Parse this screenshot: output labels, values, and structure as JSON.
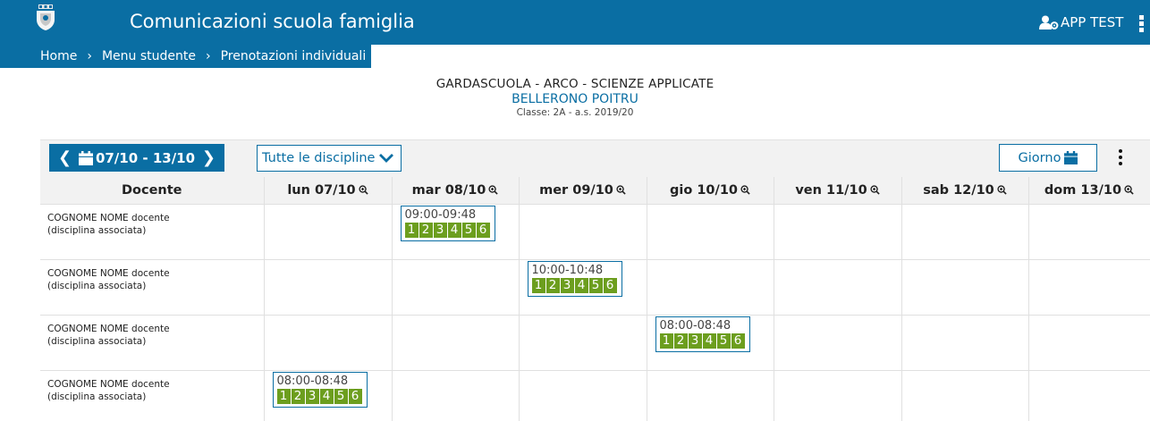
{
  "header": {
    "title": "Comunicazioni scuola famiglia",
    "user": "APP TEST"
  },
  "breadcrumb": [
    "Home",
    "Menu studente",
    "Prenotazioni individuali"
  ],
  "breadcrumb_separator": "›",
  "school": {
    "name": "GARDASCUOLA - ARCO - SCIENZE APPLICATE",
    "student": "BELLERONO POITRU",
    "class_info": "Classe: 2A - a.s. 2019/20"
  },
  "toolbar": {
    "week_range": "07/10 - 13/10",
    "prev_label": "❮",
    "next_label": "❯",
    "discipline": "Tutte le discipline",
    "day_button": "Giorno"
  },
  "table": {
    "teacher_header": "Docente",
    "days": [
      "lun 07/10",
      "mar 08/10",
      "mer 09/10",
      "gio 10/10",
      "ven 11/10",
      "sab 12/10",
      "dom 13/10"
    ],
    "rows": [
      {
        "teacher": "COGNOME NOME docente",
        "subject": "(disciplina associata)",
        "day": 1,
        "time": "09:00-09:48",
        "slots": [
          "1",
          "2",
          "3",
          "4",
          "5",
          "6"
        ]
      },
      {
        "teacher": "COGNOME NOME docente",
        "subject": "(disciplina associata)",
        "day": 2,
        "time": "10:00-10:48",
        "slots": [
          "1",
          "2",
          "3",
          "4",
          "5",
          "6"
        ]
      },
      {
        "teacher": "COGNOME NOME docente",
        "subject": "(disciplina associata)",
        "day": 3,
        "time": "08:00-08:48",
        "slots": [
          "1",
          "2",
          "3",
          "4",
          "5",
          "6"
        ]
      },
      {
        "teacher": "COGNOME NOME docente",
        "subject": "(disciplina associata)",
        "day": 0,
        "time": "08:00-08:48",
        "slots": [
          "1",
          "2",
          "3",
          "4",
          "5",
          "6"
        ]
      }
    ]
  },
  "colors": {
    "primary": "#0a6ea3",
    "slot_green": "#6c9e1e",
    "header_gray": "#f2f2f2"
  }
}
